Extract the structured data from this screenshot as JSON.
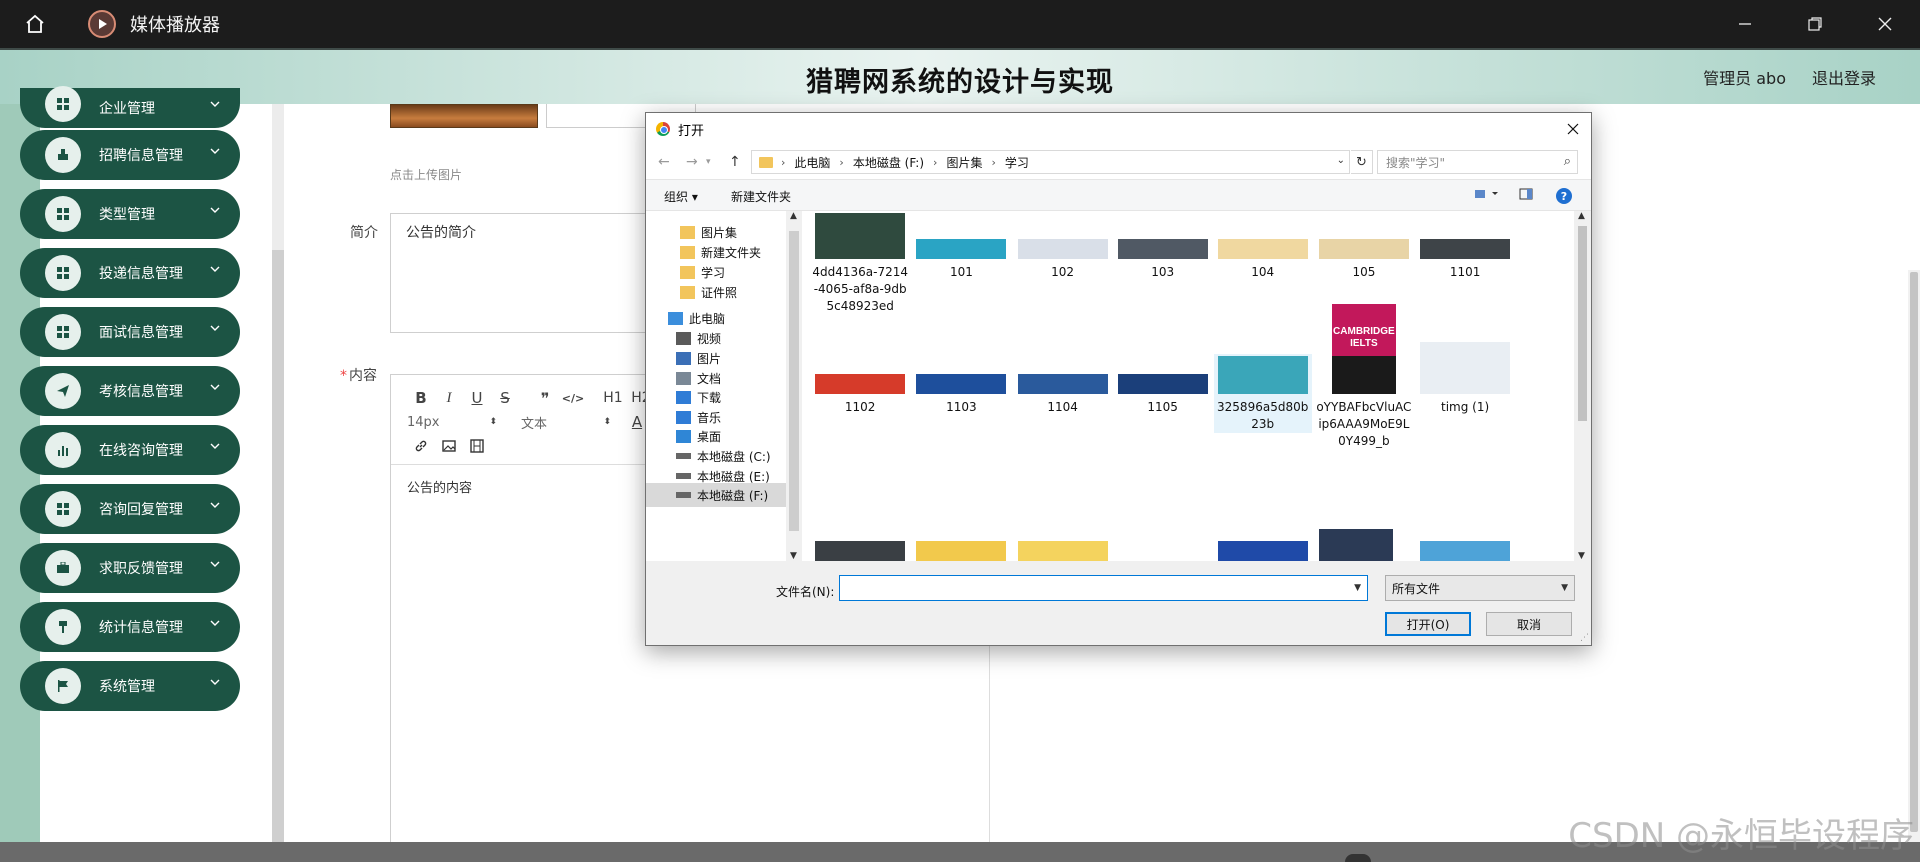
{
  "player": {
    "title": "媒体播放器",
    "accent": "#d88c75"
  },
  "site": {
    "title": "猎聘网系统的设计与实现",
    "user": "管理员 abo",
    "logout": "退出登录",
    "accent": "#1c5444"
  },
  "sidebar": {
    "items": [
      {
        "label": "企业管理",
        "icon": "grid-icon"
      },
      {
        "label": "招聘信息管理",
        "icon": "stamp-icon"
      },
      {
        "label": "类型管理",
        "icon": "grid-icon"
      },
      {
        "label": "投递信息管理",
        "icon": "grid-icon"
      },
      {
        "label": "面试信息管理",
        "icon": "grid-icon"
      },
      {
        "label": "考核信息管理",
        "icon": "send-icon"
      },
      {
        "label": "在线咨询管理",
        "icon": "bar-chart-icon"
      },
      {
        "label": "咨询回复管理",
        "icon": "grid-icon"
      },
      {
        "label": "求职反馈管理",
        "icon": "briefcase-icon"
      },
      {
        "label": "统计信息管理",
        "icon": "pin-icon"
      },
      {
        "label": "系统管理",
        "icon": "flag-icon"
      }
    ]
  },
  "form": {
    "upload_hint": "点击上传图片",
    "intro_label": "简介",
    "intro_value": "公告的简介",
    "content_label": "内容",
    "required_mark": "*",
    "content_value": "公告的内容",
    "toolbar": {
      "bold": "B",
      "italic": "I",
      "underline": "U",
      "strike": "S",
      "quote": "❞",
      "code": "</>",
      "h1": "H1",
      "h2": "H2",
      "font_size": "14px",
      "block_type": "文本",
      "font_color": "A"
    }
  },
  "dialog": {
    "title": "打开",
    "breadcrumb": [
      "此电脑",
      "本地磁盘 (F:)",
      "图片集",
      "学习"
    ],
    "search_placeholder": "搜索\"学习\"",
    "organize": "组织 ▾",
    "new_folder": "新建文件夹",
    "help": "?",
    "nav_items": [
      {
        "label": "图片集",
        "icon": "folder-icon"
      },
      {
        "label": "新建文件夹",
        "icon": "folder-icon"
      },
      {
        "label": "学习",
        "icon": "folder-icon"
      },
      {
        "label": "证件照",
        "icon": "folder-icon"
      },
      {
        "label": "此电脑",
        "icon": "computer-icon"
      },
      {
        "label": "视频",
        "icon": "video-icon"
      },
      {
        "label": "图片",
        "icon": "picture-icon"
      },
      {
        "label": "文档",
        "icon": "document-icon"
      },
      {
        "label": "下载",
        "icon": "download-icon"
      },
      {
        "label": "音乐",
        "icon": "music-icon"
      },
      {
        "label": "桌面",
        "icon": "desktop-icon"
      },
      {
        "label": "本地磁盘 (C:)",
        "icon": "drive-icon"
      },
      {
        "label": "本地磁盘 (E:)",
        "icon": "drive-icon"
      },
      {
        "label": "本地磁盘 (F:)",
        "icon": "drive-icon"
      }
    ],
    "files": [
      {
        "name": "4dd4136a-7214-4065-af8a-9db5c48923ed",
        "color": "#2f4a3e"
      },
      {
        "name": "101",
        "color": "#2aa4c4"
      },
      {
        "name": "102",
        "color": "#d9dfe8"
      },
      {
        "name": "103",
        "color": "#505964"
      },
      {
        "name": "104",
        "color": "#f0d8a0"
      },
      {
        "name": "105",
        "color": "#e8d4a6"
      },
      {
        "name": "1101",
        "color": "#3e4448"
      },
      {
        "name": "1102",
        "color": "#d63b2a"
      },
      {
        "name": "1103",
        "color": "#1e4f9c"
      },
      {
        "name": "1104",
        "color": "#2a5a9c"
      },
      {
        "name": "1105",
        "color": "#1b3f7a"
      },
      {
        "name": "325896a5d80b23b",
        "color": "#3aa6b9"
      },
      {
        "name": "oYYBAFbcVluACip6AAA9MoE9L0Y499_b",
        "color": "#c2185b"
      },
      {
        "name": "timg (1)",
        "color": "#e9eef3"
      }
    ],
    "file_name_label": "文件名(N):",
    "file_name_value": "",
    "file_type": "所有文件",
    "open_button": "打开(O)",
    "cancel_button": "取消"
  },
  "ielts_text": "CAMBRIDGE IELTS",
  "watermark": "CSDN @永恒毕设程序"
}
